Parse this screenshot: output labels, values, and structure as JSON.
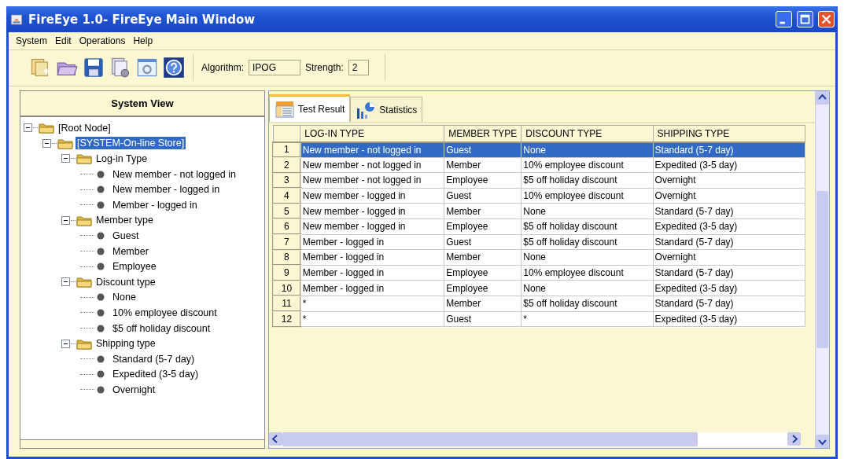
{
  "window": {
    "title": "FireEye 1.0- FireEye Main Window"
  },
  "menu": [
    "System",
    "Edit",
    "Operations",
    "Help"
  ],
  "toolbar": {
    "algorithm_label": "Algorithm:",
    "algorithm": "IPOG",
    "strength_label": "Strength:",
    "strength": "2"
  },
  "system_view": {
    "title": "System View",
    "tree": [
      {
        "label": "[Root Node]",
        "expanded": true,
        "selected": false,
        "children": [
          {
            "label": "[SYSTEM-On-line Store]",
            "expanded": true,
            "selected": true,
            "children": [
              {
                "label": "Log-in Type",
                "expanded": true,
                "selected": false,
                "children": [
                  {
                    "label": "New member - not logged in",
                    "selected": false
                  },
                  {
                    "label": "New member - logged in",
                    "selected": false
                  },
                  {
                    "label": "Member - logged in",
                    "selected": false
                  }
                ]
              },
              {
                "label": "Member type",
                "expanded": true,
                "selected": false,
                "children": [
                  {
                    "label": "Guest",
                    "selected": false
                  },
                  {
                    "label": "Member",
                    "selected": false
                  },
                  {
                    "label": "Employee",
                    "selected": false
                  }
                ]
              },
              {
                "label": "Discount type",
                "expanded": true,
                "selected": false,
                "children": [
                  {
                    "label": "None",
                    "selected": false
                  },
                  {
                    "label": "10% employee discount",
                    "selected": false
                  },
                  {
                    "label": "$5 off holiday discount",
                    "selected": false
                  }
                ]
              },
              {
                "label": "Shipping type",
                "expanded": true,
                "selected": false,
                "children": [
                  {
                    "label": "Standard (5-7 day)",
                    "selected": false
                  },
                  {
                    "label": "Expedited (3-5 day)",
                    "selected": false
                  },
                  {
                    "label": "Overnight",
                    "selected": false
                  }
                ]
              }
            ]
          }
        ]
      }
    ]
  },
  "tabs": [
    {
      "label": "Test Result",
      "selected": true,
      "kind": "table"
    },
    {
      "label": "Statistics",
      "selected": false,
      "kind": "chart"
    }
  ],
  "table": {
    "columns": [
      "LOG-IN TYPE",
      "MEMBER TYPE",
      "DISCOUNT TYPE",
      "SHIPPING TYPE"
    ],
    "rows": [
      {
        "number": "1",
        "cells": [
          "New member - not logged in",
          "Guest",
          "None",
          "Standard (5-7 day)"
        ],
        "selected": true
      },
      {
        "number": "2",
        "cells": [
          "New member - not logged in",
          "Member",
          "10% employee discount",
          "Expedited (3-5 day)"
        ],
        "selected": false
      },
      {
        "number": "3",
        "cells": [
          "New member - not logged in",
          "Employee",
          "$5 off holiday discount",
          "Overnight"
        ],
        "selected": false
      },
      {
        "number": "4",
        "cells": [
          "New member - logged in",
          "Guest",
          "10% employee discount",
          "Overnight"
        ],
        "selected": false
      },
      {
        "number": "5",
        "cells": [
          "New member - logged in",
          "Member",
          "None",
          "Standard (5-7 day)"
        ],
        "selected": false
      },
      {
        "number": "6",
        "cells": [
          "New member - logged in",
          "Employee",
          "$5 off holiday discount",
          "Expedited (3-5 day)"
        ],
        "selected": false
      },
      {
        "number": "7",
        "cells": [
          "Member - logged in",
          "Guest",
          "$5 off holiday discount",
          "Standard (5-7 day)"
        ],
        "selected": false
      },
      {
        "number": "8",
        "cells": [
          "Member - logged in",
          "Member",
          "None",
          "Overnight"
        ],
        "selected": false
      },
      {
        "number": "9",
        "cells": [
          "Member - logged in",
          "Employee",
          "10% employee discount",
          "Standard (5-7 day)"
        ],
        "selected": false
      },
      {
        "number": "10",
        "cells": [
          "Member - logged in",
          "Employee",
          "None",
          "Expedited (3-5 day)"
        ],
        "selected": false
      },
      {
        "number": "11",
        "cells": [
          "*",
          "Member",
          "$5 off holiday discount",
          "Standard (5-7 day)"
        ],
        "selected": false
      },
      {
        "number": "12",
        "cells": [
          "*",
          "Guest",
          "*",
          "Expedited (3-5 day)"
        ],
        "selected": false
      }
    ]
  }
}
